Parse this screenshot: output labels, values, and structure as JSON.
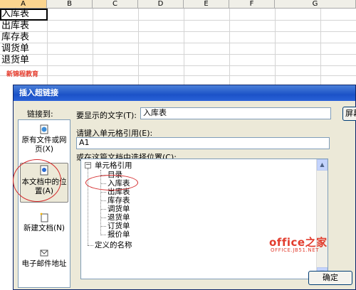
{
  "sheet": {
    "columns": [
      "A",
      "B",
      "C",
      "D",
      "E",
      "F",
      "G"
    ],
    "cells": [
      "入库表",
      "出库表",
      "库存表",
      "调货单",
      "退货单"
    ],
    "small_note": "新锦程教育"
  },
  "dialog": {
    "title": "插入超链接",
    "link_to_label": "链接到:",
    "nav": {
      "existing": "原有文件或网页(X)",
      "this_doc": "本文档中的位置(A)",
      "new_doc": "新建文档(N)",
      "email": "电子邮件地址"
    },
    "text_to_display_label": "要显示的文字(T):",
    "text_to_display_value": "入库表",
    "screen_tip_button": "屏幕",
    "cell_ref_label": "请键入单元格引用(E):",
    "cell_ref_value": "A1",
    "place_label": "或在这篇文档中选择位置(C):",
    "tree": {
      "root": "单元格引用",
      "items": [
        "目录",
        "入库表",
        "出库表",
        "库存表",
        "调货单",
        "退货单",
        "订货单",
        "报价单"
      ],
      "defined_names": "定义的名称"
    },
    "ok_button": "确定"
  },
  "watermark": {
    "main": "office之家",
    "sub": "OFFICE.JB51.NET"
  },
  "colors": {
    "titlebar": "#1b52c7",
    "annotation": "#d4282a",
    "dialog_bg": "#ece9d8"
  }
}
